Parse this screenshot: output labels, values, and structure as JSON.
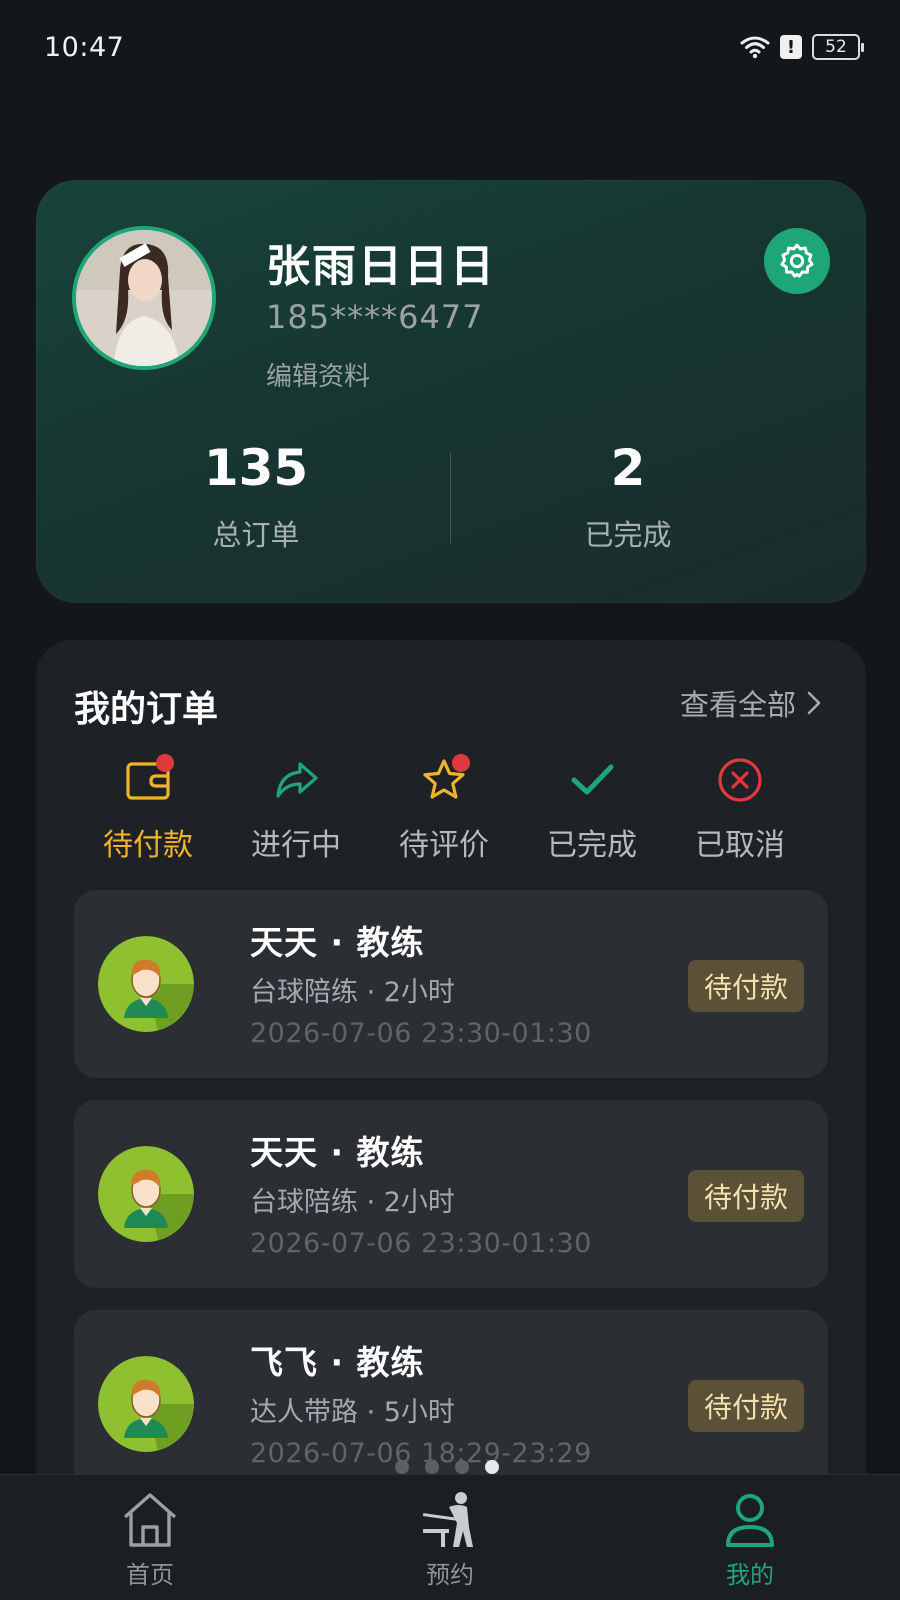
{
  "status_bar": {
    "time": "10:47",
    "battery": "52",
    "alert": "!"
  },
  "profile": {
    "name": "张雨日日日",
    "phone": "185****6477",
    "edit_label": "编辑资料",
    "stats": [
      {
        "value": "135",
        "label": "总订单"
      },
      {
        "value": "2",
        "label": "已完成"
      }
    ]
  },
  "orders": {
    "title": "我的订单",
    "view_all": "查看全部",
    "tabs": [
      {
        "label": "待付款",
        "icon": "wallet-icon",
        "active": true,
        "badge": true
      },
      {
        "label": "进行中",
        "icon": "share-arrow-icon",
        "active": false,
        "badge": false
      },
      {
        "label": "待评价",
        "icon": "star-icon",
        "active": false,
        "badge": true
      },
      {
        "label": "已完成",
        "icon": "check-icon",
        "active": false,
        "badge": false
      },
      {
        "label": "已取消",
        "icon": "cancel-circle-icon",
        "active": false,
        "badge": false
      }
    ],
    "items": [
      {
        "coach": "天天 · 教练",
        "service": "台球陪练 · 2小时",
        "time": "2026-07-06 23:30-01:30",
        "status": "待付款"
      },
      {
        "coach": "天天 · 教练",
        "service": "台球陪练 · 2小时",
        "time": "2026-07-06 23:30-01:30",
        "status": "待付款"
      },
      {
        "coach": "飞飞 · 教练",
        "service": "达人带路 · 5小时",
        "time": "2026-07-06 18:29-23:29",
        "status": "待付款"
      }
    ]
  },
  "nav": {
    "items": [
      {
        "label": "首页",
        "icon": "home-icon",
        "active": false
      },
      {
        "label": "预约",
        "icon": "billiards-player-icon",
        "active": false
      },
      {
        "label": "我的",
        "icon": "user-icon",
        "active": true
      }
    ]
  },
  "colors": {
    "accent": "#1fa678",
    "pending": "#f0b429",
    "badge_red": "#e0393c"
  }
}
